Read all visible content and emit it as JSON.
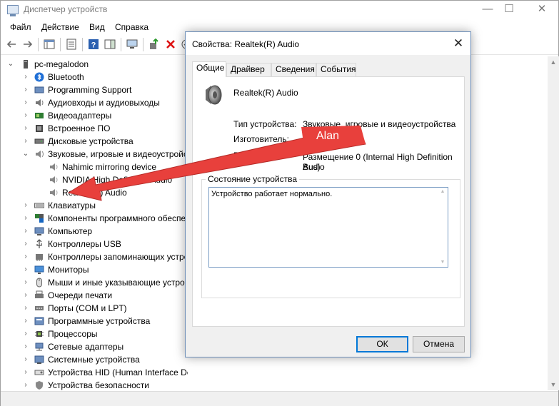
{
  "window": {
    "title": "Диспетчер устройств",
    "minimize": "—",
    "maximize": "☐",
    "close": "✕"
  },
  "menu": [
    "Файл",
    "Действие",
    "Вид",
    "Справка"
  ],
  "tree": {
    "root": "pc-megalodon",
    "items": [
      {
        "label": "Bluetooth",
        "icon": "bluetooth-icon",
        "expanded": false
      },
      {
        "label": "Programming Support",
        "icon": "device-icon",
        "expanded": false
      },
      {
        "label": "Аудиовходы и аудиовыходы",
        "icon": "audio-io-icon",
        "expanded": false
      },
      {
        "label": "Видеоадаптеры",
        "icon": "display-adapter-icon",
        "expanded": false
      },
      {
        "label": "Встроенное ПО",
        "icon": "firmware-icon",
        "expanded": false
      },
      {
        "label": "Дисковые устройства",
        "icon": "disk-icon",
        "expanded": false
      },
      {
        "label": "Звуковые, игровые и видеоустройства",
        "icon": "sound-icon",
        "expanded": true
      },
      {
        "label": "Nahimic mirroring device",
        "icon": "speaker-icon",
        "child": true
      },
      {
        "label": "NVIDIA High Definition Audio",
        "icon": "speaker-icon",
        "child": true
      },
      {
        "label": "Realtek(R) Audio",
        "icon": "speaker-icon",
        "child": true
      },
      {
        "label": "Клавиатуры",
        "icon": "keyboard-icon",
        "expanded": false
      },
      {
        "label": "Компоненты программного обеспечения",
        "icon": "software-icon",
        "expanded": false
      },
      {
        "label": "Компьютер",
        "icon": "computer-icon",
        "expanded": false
      },
      {
        "label": "Контроллеры USB",
        "icon": "usb-icon",
        "expanded": false
      },
      {
        "label": "Контроллеры запоминающих устройств",
        "icon": "storage-icon",
        "expanded": false
      },
      {
        "label": "Мониторы",
        "icon": "monitor-icon",
        "expanded": false
      },
      {
        "label": "Мыши и иные указывающие устройства",
        "icon": "mouse-icon",
        "expanded": false
      },
      {
        "label": "Очереди печати",
        "icon": "printer-icon",
        "expanded": false
      },
      {
        "label": "Порты (COM и LPT)",
        "icon": "port-icon",
        "expanded": false
      },
      {
        "label": "Программные устройства",
        "icon": "software-device-icon",
        "expanded": false
      },
      {
        "label": "Процессоры",
        "icon": "cpu-icon",
        "expanded": false
      },
      {
        "label": "Сетевые адаптеры",
        "icon": "network-icon",
        "expanded": false
      },
      {
        "label": "Системные устройства",
        "icon": "system-icon",
        "expanded": false
      },
      {
        "label": "Устройства HID (Human Interface Devices)",
        "icon": "hid-icon",
        "expanded": false
      },
      {
        "label": "Устройства безопасности",
        "icon": "security-icon",
        "expanded": false
      }
    ]
  },
  "dialog": {
    "title": "Свойства: Realtek(R) Audio",
    "tabs": [
      "Общие",
      "Драйвер",
      "Сведения",
      "События"
    ],
    "device_name": "Realtek(R) Audio",
    "type_label": "Тип устройства:",
    "type_value": "Звуковые, игровые и видеоустройства",
    "manufacturer_label": "Изготовитель:",
    "location_label": "Размещение:",
    "location_value_line1": "Размещение 0 (Internal High Definition Audio",
    "location_value_line2": "Bus)",
    "status_group": "Состояние устройства",
    "status_text": "Устройство работает нормально.",
    "ok": "ОК",
    "cancel": "Отмена"
  },
  "annotation": {
    "label": "Alan",
    "color": "#e8403c"
  }
}
